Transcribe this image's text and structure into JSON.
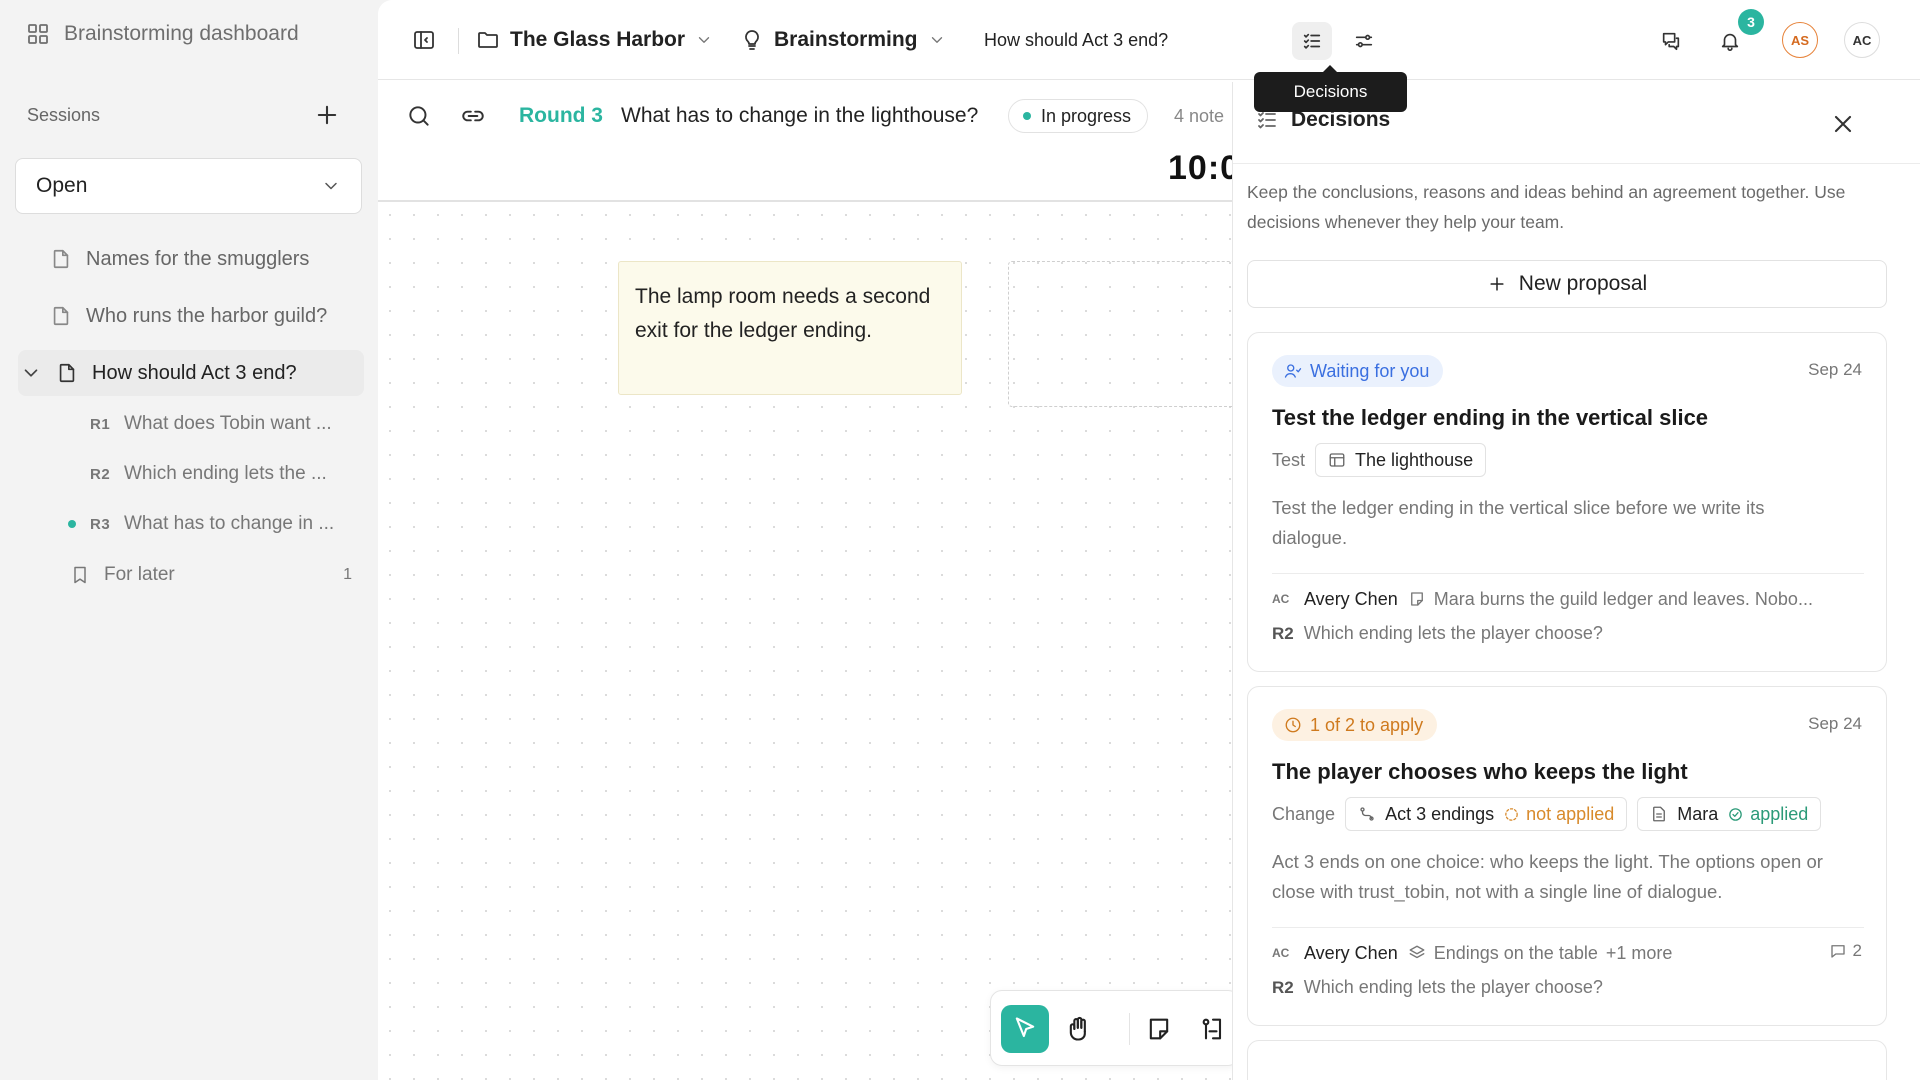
{
  "sidebar": {
    "title": "Brainstorming dashboard",
    "sessions_label": "Sessions",
    "filter_value": "Open",
    "items": [
      {
        "label": "Names for the smugglers"
      },
      {
        "label": "Who runs the harbor guild?"
      },
      {
        "label": "How should Act 3 end?"
      }
    ],
    "rounds": [
      {
        "tag": "R1",
        "label": "What does Tobin want ..."
      },
      {
        "tag": "R2",
        "label": "Which ending lets the ..."
      },
      {
        "tag": "R3",
        "label": "What has to change in ..."
      }
    ],
    "later": {
      "label": "For later",
      "count": "1"
    }
  },
  "topbar": {
    "project": "The Glass Harbor",
    "mode": "Brainstorming",
    "question": "How should Act 3 end?",
    "notifications_count": "3",
    "avatar_1": "AS",
    "avatar_2": "AC"
  },
  "tooltip": "Decisions",
  "roundbar": {
    "round": "Round 3",
    "question": "What has to change in the lighthouse?",
    "status": "In progress",
    "notes": "4 note",
    "timer": "10:0"
  },
  "canvas": {
    "sticky_text": "The lamp room needs a second exit for the ledger ending."
  },
  "panel": {
    "title": "Decisions",
    "description": "Keep the conclusions, reasons and ideas behind an agreement together. Use decisions whenever they help your team.",
    "new_proposal": "New proposal",
    "cards": [
      {
        "status": "Waiting for you",
        "date": "Sep 24",
        "title": "Test the ledger ending in the vertical slice",
        "type": "Test",
        "chip": "The lighthouse",
        "body": "Test the ledger ending in the vertical slice before we write its dialogue.",
        "author_initials": "AC",
        "author": "Avery Chen",
        "ref": "Mara burns the guild ledger and leaves. Nobo...",
        "round_tag": "R2",
        "round_q": "Which ending lets the player choose?"
      },
      {
        "status": "1 of 2 to apply",
        "date": "Sep 24",
        "title": "The player chooses who keeps the light",
        "type": "Change",
        "chip1": "Act 3 endings",
        "chip1_state": "not applied",
        "chip2": "Mara",
        "chip2_state": "applied",
        "body": "Act 3 ends on one choice: who keeps the light. The options open or close with trust_tobin, not with a single line of dialogue.",
        "author_initials": "AC",
        "author": "Avery Chen",
        "ref": "Endings on the table",
        "ref_more": "+1 more",
        "comments": "2",
        "round_tag": "R2",
        "round_q": "Which ending lets the player choose?"
      }
    ]
  },
  "colors": {
    "accent": "#2bb5a0",
    "waiting": "#3a6fe0",
    "pending": "#cf7a1e",
    "applied": "#2b9a78"
  }
}
